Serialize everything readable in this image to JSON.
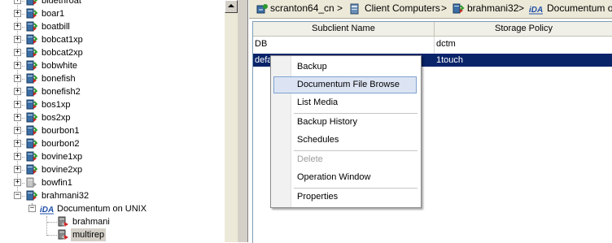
{
  "tree": {
    "items": [
      {
        "label": "bluethroat",
        "icon": "client-computer-icon"
      },
      {
        "label": "boar1",
        "icon": "client-computer-icon"
      },
      {
        "label": "boatbill",
        "icon": "client-computer-icon"
      },
      {
        "label": "bobcat1xp",
        "icon": "client-computer-icon"
      },
      {
        "label": "bobcat2xp",
        "icon": "client-computer-icon"
      },
      {
        "label": "bobwhite",
        "icon": "client-computer-icon"
      },
      {
        "label": "bonefish",
        "icon": "client-computer-icon"
      },
      {
        "label": "bonefish2",
        "icon": "client-computer-icon"
      },
      {
        "label": "bos1xp",
        "icon": "client-computer-icon"
      },
      {
        "label": "bos2xp",
        "icon": "client-computer-icon"
      },
      {
        "label": "bourbon1",
        "icon": "client-computer-icon"
      },
      {
        "label": "bourbon2",
        "icon": "client-computer-icon"
      },
      {
        "label": "bovine1xp",
        "icon": "client-computer-icon"
      },
      {
        "label": "bovine2xp",
        "icon": "client-computer-icon"
      },
      {
        "label": "bowfin1",
        "icon": "client-computer-disabled-icon"
      },
      {
        "label": "brahmani32",
        "icon": "client-computer-icon"
      },
      {
        "label": "Documentum on UNIX",
        "icon": "ida-icon"
      },
      {
        "label": "brahmani",
        "icon": "instance-icon"
      },
      {
        "label": "multirep",
        "icon": "instance-icon"
      }
    ]
  },
  "breadcrumb": {
    "items": [
      {
        "label": "scranton64_cn",
        "icon": "commcell-icon"
      },
      {
        "label": "Client Computers",
        "icon": "client-computers-icon"
      },
      {
        "label": "brahmani32",
        "icon": "client-computer-icon"
      },
      {
        "label": "Documentum on",
        "icon": "ida-icon"
      }
    ],
    "separator": ">"
  },
  "table": {
    "columns": [
      "Subclient Name",
      "Storage Policy"
    ],
    "rows": [
      {
        "name": "DB",
        "policy": "dctm"
      },
      {
        "name": "default",
        "policy": "1touch"
      }
    ]
  },
  "context_menu": {
    "items": [
      {
        "label": "Backup"
      },
      {
        "label": "Documentum File Browse"
      },
      {
        "label": "List Media"
      },
      {
        "label": "Backup History"
      },
      {
        "label": "Schedules"
      },
      {
        "label": "Delete"
      },
      {
        "label": "Operation Window"
      },
      {
        "label": "Properties"
      }
    ]
  },
  "colors": {
    "selection": "#0a246a",
    "menu_hover": "#dce4f4",
    "ida_icon": "#1f4fa8",
    "toolbar_bg": "#ece9d8"
  }
}
